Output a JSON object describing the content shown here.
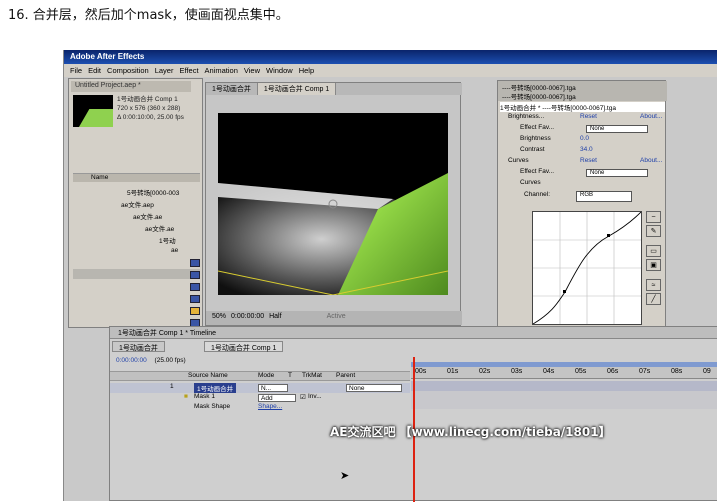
{
  "caption": "16. 合并层，然后加个mask，使画面视点集中。",
  "app": {
    "title": "Adobe After Effects",
    "menu": [
      "File",
      "Edit",
      "Composition",
      "Layer",
      "Effect",
      "Animation",
      "View",
      "Window",
      "Help"
    ]
  },
  "project": {
    "tab": "Untitled Project.aep *",
    "comp_name": "1号动画合并 Comp 1",
    "comp_size": "720 x 576  (360 x 288)",
    "comp_duration": "Δ 0:00:10:00, 25.00 fps",
    "col_name": "Name",
    "items": [
      "5号转场[0000-003",
      "ae文件.aep",
      "ae文件.ae",
      "ae文件.ae",
      "1号动",
      "ae"
    ]
  },
  "comp_viewer": {
    "tabs": [
      "1号动画合并",
      "1号动画合并 Comp 1"
    ],
    "zoom": "50%",
    "timecode": "0:00:00:00",
    "resolution": "Half",
    "active": "Active"
  },
  "effects": {
    "tab1": "----号转场[0000-0067].tga",
    "tab2": "----号转场[0000-0067].tga",
    "title": "1号动画合并 * ----号转场[0000-0067].tga",
    "brightness_label": "Brightness...",
    "reset": "Reset",
    "about": "About...",
    "effect_fav": "Effect Fav...",
    "none": "None",
    "brightness": "Brightness",
    "brightness_val": "0.0",
    "contrast": "Contrast",
    "contrast_val": "34.0",
    "curves_label": "Curves",
    "curves": "Curves",
    "channel_label": "Channel:",
    "channel_val": "RGB"
  },
  "timeline": {
    "title": "1号动画合并 Comp 1 * Timeline",
    "tabs": [
      "1号动画合并",
      "1号动画合并 Comp 1"
    ],
    "timecode": "0:00:00:00",
    "fps": "(25.00 fps)",
    "headers": {
      "source": "Source Name",
      "mode": "Mode",
      "t": "T",
      "trkmat": "TrkMat",
      "parent": "Parent"
    },
    "layer_num": "1",
    "layer_name": "1号动画合并",
    "layer_mode": "N...",
    "parent_val": "None",
    "mask": "Mask 1",
    "mask_mode": "Add",
    "mask_inv": "Inv...",
    "mask_shape": "Mask Shape",
    "mask_shape_val": "Shape...",
    "ruler": [
      "00s",
      "01s",
      "02s",
      "03s",
      "04s",
      "05s",
      "06s",
      "07s",
      "08s",
      "09"
    ]
  },
  "watermark": "AE交流区吧 【www.linecg.com/tieba/1801】"
}
